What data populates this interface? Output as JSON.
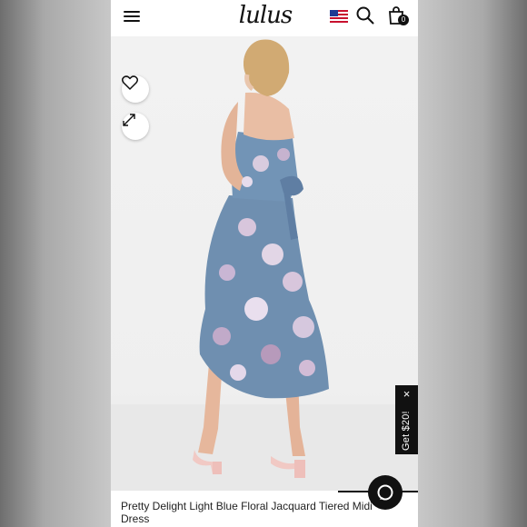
{
  "header": {
    "logo_text": "lulus",
    "menu_icon": "hamburger-menu-icon",
    "flag_icon": "us-flag-icon",
    "search_icon": "search-icon",
    "bag_icon": "shopping-bag-icon",
    "bag_count": "0"
  },
  "product": {
    "title": "Pretty Delight Light Blue Floral Jacquard Tiered Midi Dress",
    "favorite_icon": "heart-icon",
    "expand_icon": "expand-icon",
    "image_colors": {
      "dress": "#6f8fb0",
      "flowers": "#d8c6dc"
    }
  },
  "promo": {
    "label": "Get $20!",
    "close_icon": "close-icon"
  },
  "chat": {
    "icon": "chat-bubble-icon"
  },
  "colors": {
    "accent": "#111111",
    "background": "#ffffff"
  }
}
